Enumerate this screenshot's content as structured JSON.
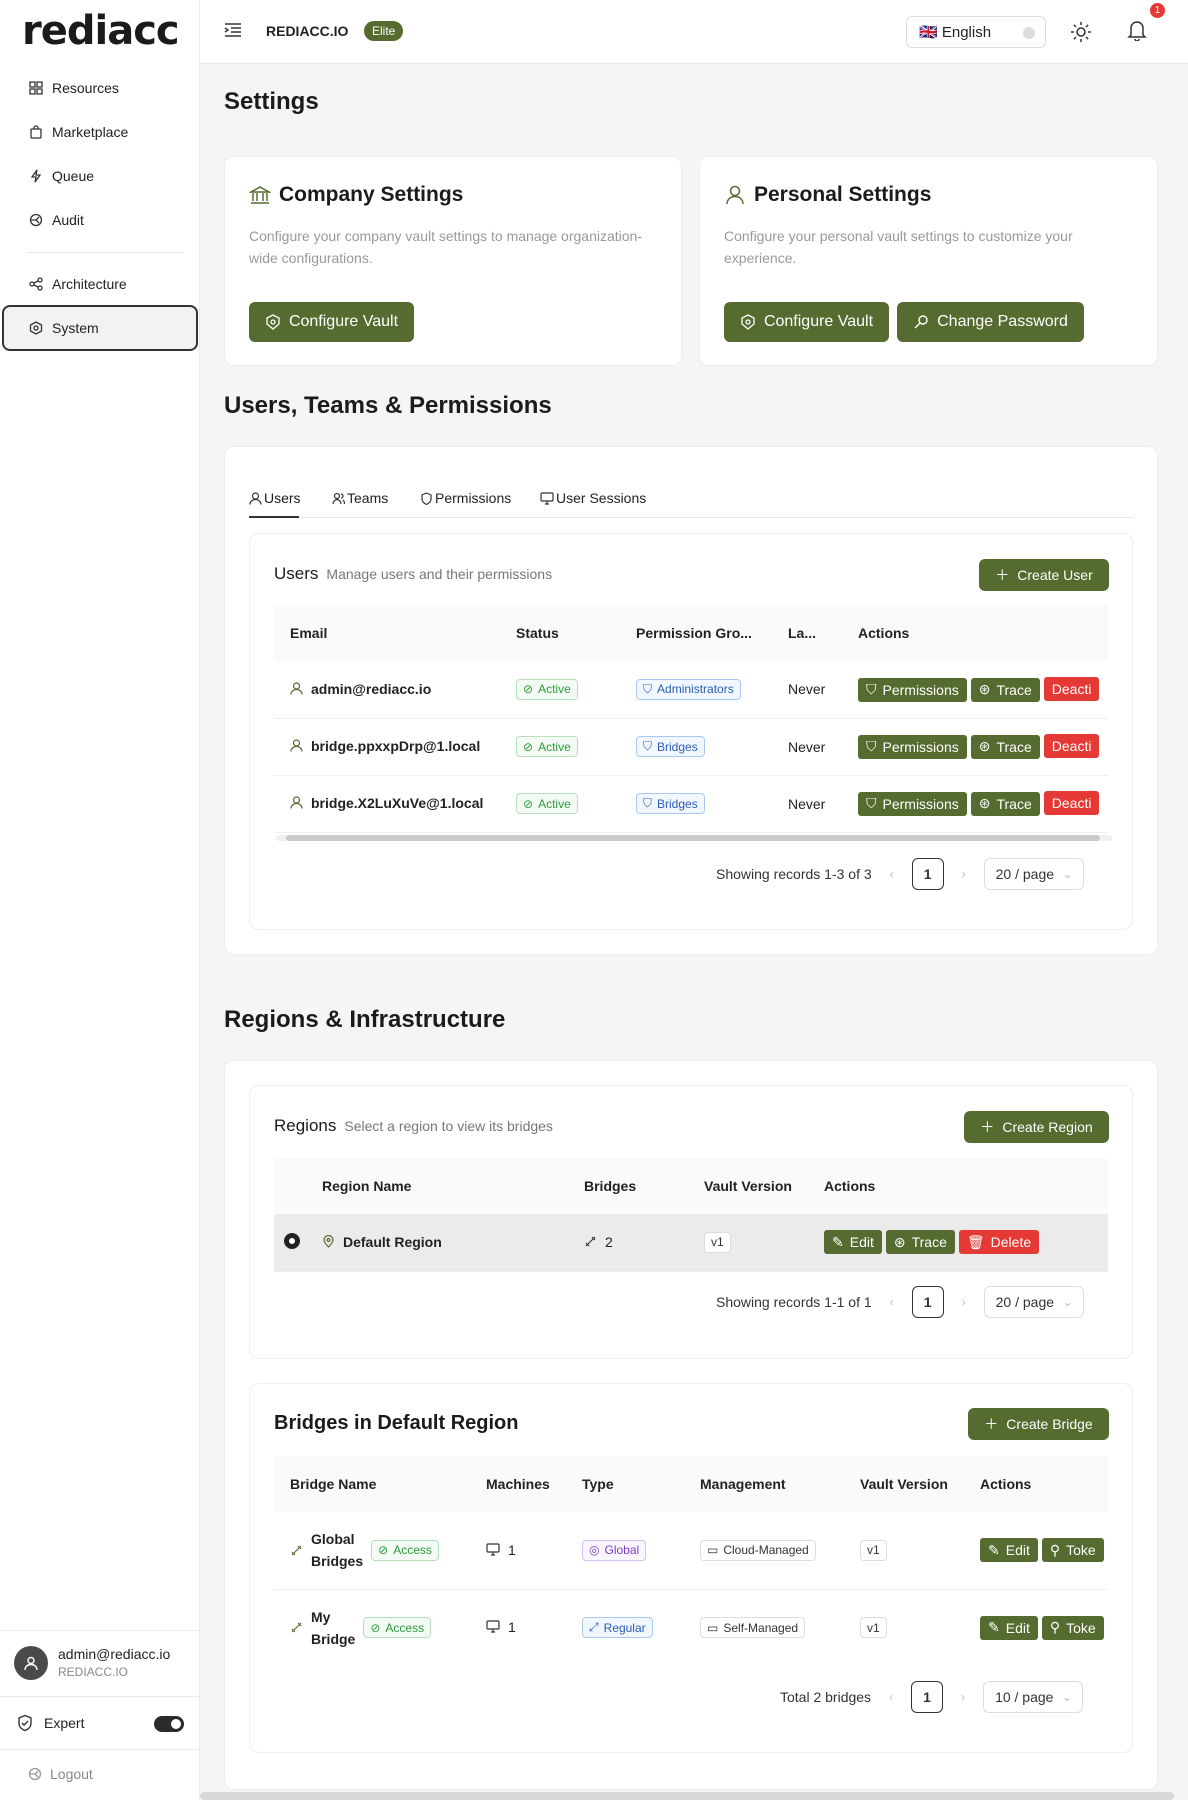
{
  "app": {
    "logo": "rediacc",
    "org": "REDIACC.IO",
    "plan": "Elite",
    "language": "🇬🇧 English",
    "notifications": "1"
  },
  "sidebar": {
    "items": [
      {
        "label": "Resources"
      },
      {
        "label": "Marketplace"
      },
      {
        "label": "Queue"
      },
      {
        "label": "Audit"
      },
      {
        "label": "Architecture"
      },
      {
        "label": "System"
      }
    ],
    "user_email": "admin@rediacc.io",
    "user_org": "REDIACC.IO",
    "expert_label": "Expert",
    "expert_enabled": true,
    "logout_label": "Logout"
  },
  "page": {
    "title": "Settings",
    "company": {
      "title": "Company Settings",
      "desc": "Configure your company vault settings to manage organization-wide configurations.",
      "button": "Configure Vault"
    },
    "personal": {
      "title": "Personal Settings",
      "desc": "Configure your personal vault settings to customize your experience.",
      "vault_button": "Configure Vault",
      "password_button": "Change Password"
    },
    "users_section_title": "Users, Teams & Permissions",
    "tabs": [
      "Users",
      "Teams",
      "Permissions",
      "User Sessions"
    ],
    "users": {
      "title": "Users",
      "subtitle": "Manage users and their permissions",
      "create_button": "Create User",
      "columns": [
        "Email",
        "Status",
        "Permission Gro...",
        "La...",
        "Actions"
      ],
      "rows": [
        {
          "email": "admin@rediacc.io",
          "status": "Active",
          "group": "Administrators",
          "last": "Never"
        },
        {
          "email": "bridge.ppxxpDrp@1.local",
          "status": "Active",
          "group": "Bridges",
          "last": "Never"
        },
        {
          "email": "bridge.X2LuXuVe@1.local",
          "status": "Active",
          "group": "Bridges",
          "last": "Never"
        }
      ],
      "actions": [
        "Permissions",
        "Trace",
        "Deacti"
      ],
      "pager_text": "Showing records 1-3 of 3",
      "page": "1",
      "page_size": "20 / page"
    },
    "regions_section_title": "Regions & Infrastructure",
    "regions": {
      "title": "Regions",
      "subtitle": "Select a region to view its bridges",
      "create_button": "Create Region",
      "columns": [
        "Region Name",
        "Bridges",
        "Vault Version",
        "Actions"
      ],
      "rows": [
        {
          "name": "Default Region",
          "bridges": "2",
          "vault": "v1"
        }
      ],
      "actions": [
        "Edit",
        "Trace",
        "Delete"
      ],
      "pager_text": "Showing records 1-1 of 1",
      "page": "1",
      "page_size": "20 / page"
    },
    "bridges": {
      "title": "Bridges in Default Region",
      "create_button": "Create Bridge",
      "columns": [
        "Bridge Name",
        "Machines",
        "Type",
        "Management",
        "Vault Version",
        "Actions"
      ],
      "rows": [
        {
          "name_line1": "Global",
          "name_line2": "Bridges",
          "access": "Access",
          "machines": "1",
          "type": "Global",
          "management": "Cloud-Managed",
          "vault": "v1"
        },
        {
          "name_line1": "My",
          "name_line2": "Bridge",
          "access": "Access",
          "machines": "1",
          "type": "Regular",
          "management": "Self-Managed",
          "vault": "v1"
        }
      ],
      "actions": [
        "Edit",
        "Toke"
      ],
      "pager_text": "Total 2 bridges",
      "page": "1",
      "page_size": "10 / page"
    }
  },
  "colors": {
    "accent": "#556b2f",
    "danger": "#e53935",
    "success": "#2e9b3e"
  }
}
